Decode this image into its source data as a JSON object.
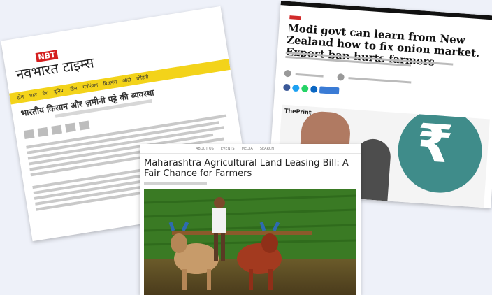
{
  "nbt": {
    "badge": "NBT",
    "logo_text": "नवभारत टाइम्स",
    "nav_items": [
      "होम",
      "शहर",
      "देश",
      "दुनिया",
      "खेल",
      "मनोरंजन",
      "बिज़नेस",
      "ऑटो",
      "वीडियो"
    ],
    "headline": "भारतीय किसान और ज़मीनी पट्टे की व्यवस्था"
  },
  "print": {
    "headline": "Modi govt can learn from New Zealand how to fix onion market. Export ban hurts farmers",
    "logo": "ThePrint",
    "share_colors": [
      "#3b5998",
      "#1da1f2",
      "#25d366",
      "#0a66c2",
      "#3a7bd5"
    ]
  },
  "center": {
    "nav_items": [
      "ABOUT US",
      "EVENTS",
      "MEDIA",
      "SEARCH"
    ],
    "headline": "Maharashtra Agricultural Land Leasing Bill: A Fair Chance for Farmers"
  }
}
